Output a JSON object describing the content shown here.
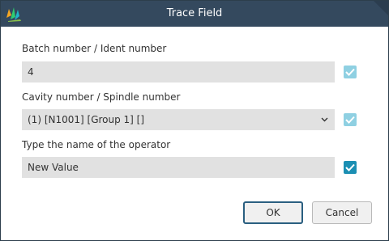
{
  "window": {
    "title": "Trace Field"
  },
  "fields": [
    {
      "label": "Batch number / Ident number",
      "value": "4",
      "checked": true,
      "enabled": false
    },
    {
      "label": "Cavity number / Spindle number",
      "value": "(1) [N1001] [Group 1] []",
      "checked": true,
      "enabled": false,
      "icon": "chevron-down-icon"
    },
    {
      "label": "Type the name of the operator",
      "value": "New Value",
      "checked": true,
      "enabled": true
    }
  ],
  "buttons": {
    "ok_label": "OK",
    "cancel_label": "Cancel"
  },
  "colors": {
    "titlebar": "#34495e",
    "field_background": "#e1e1e1",
    "checkbox_active": "#1b8fb3",
    "checkbox_disabled": "#8fd0e2",
    "ok_border": "#2a5f80",
    "cancel_border": "#b9b9b9"
  },
  "icons": {
    "app": "app-logo-icon",
    "check": "checkmark-icon"
  }
}
